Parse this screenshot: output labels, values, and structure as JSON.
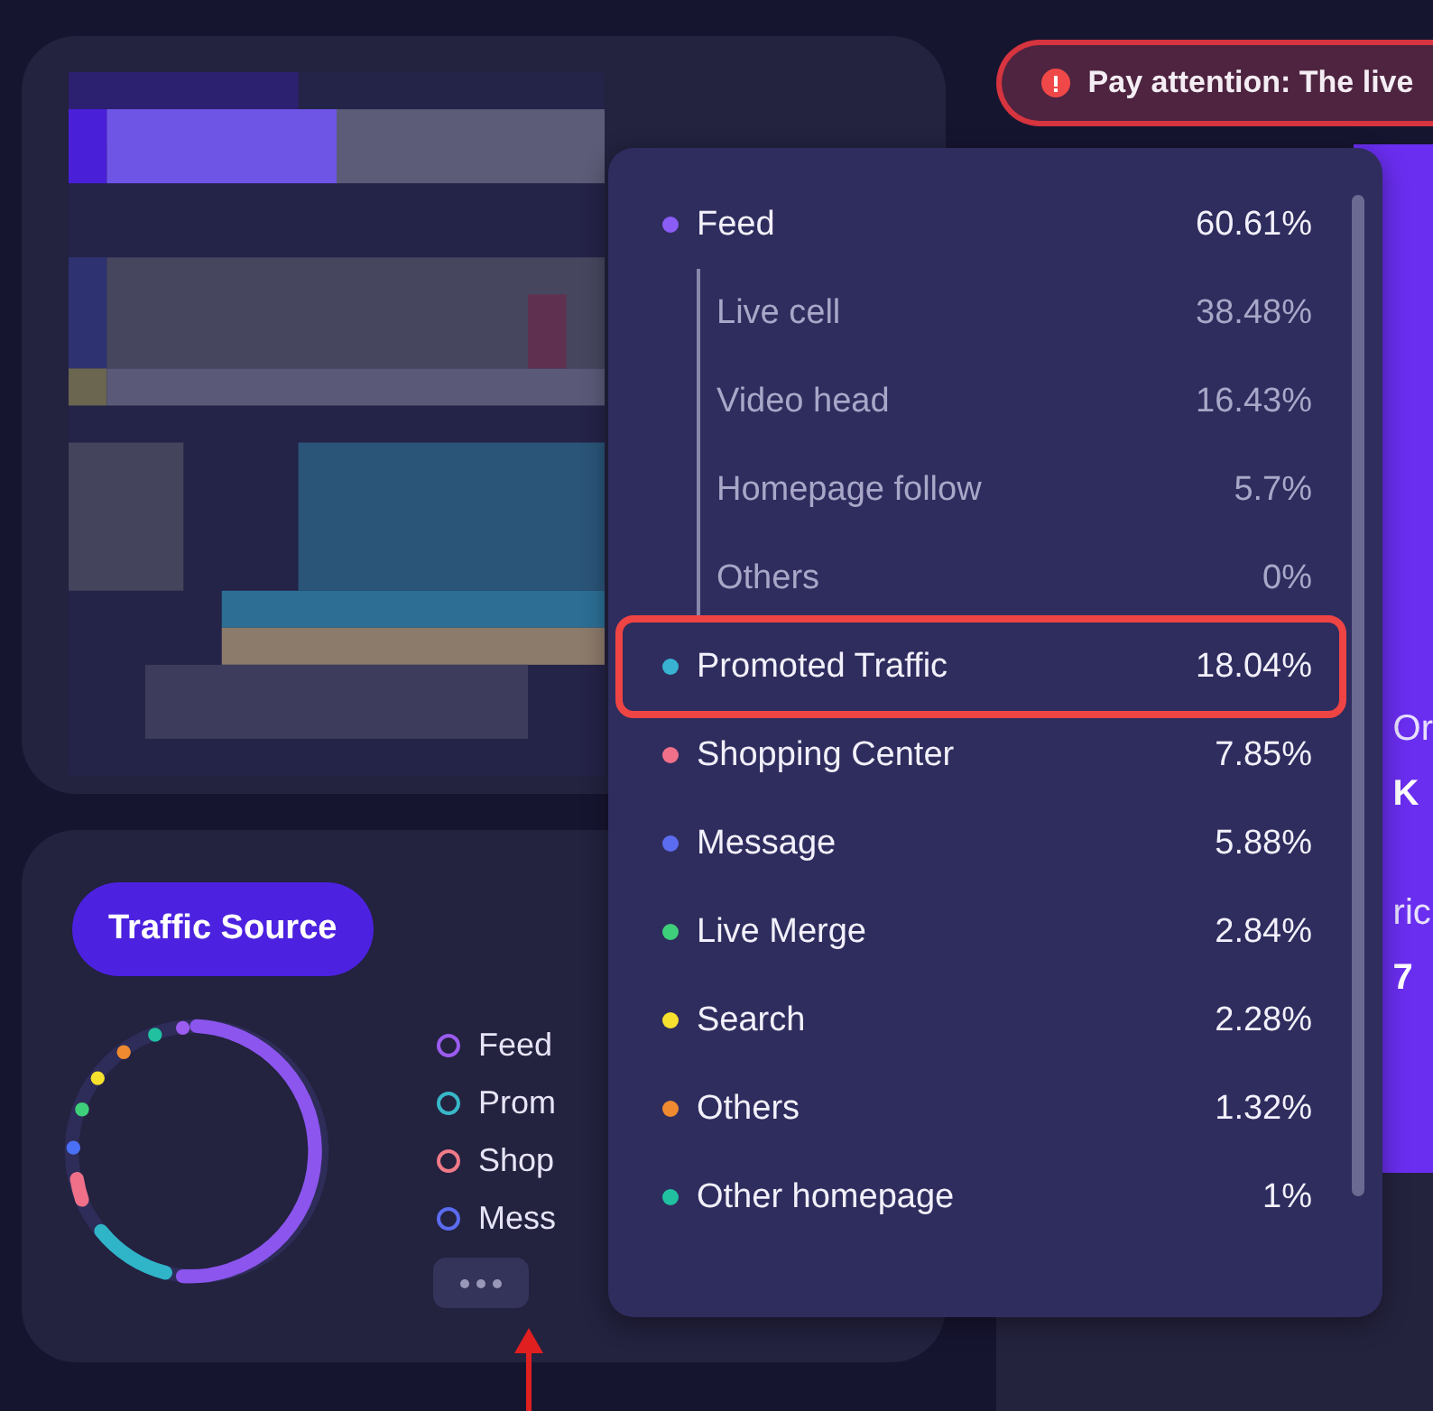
{
  "alert": {
    "text": "Pay attention: The live"
  },
  "traffic_card": {
    "title": "Traffic Source",
    "legend": [
      {
        "label": "Feed",
        "color": "#9b5cf0"
      },
      {
        "label": "Prom",
        "color": "#38b8c8"
      },
      {
        "label": "Shop",
        "color": "#f07a88"
      },
      {
        "label": "Mess",
        "color": "#5b6cf0"
      }
    ]
  },
  "stats_card": {
    "stats": [
      {
        "label": "Or",
        "value": "K"
      },
      {
        "label": "ric",
        "value": "7"
      }
    ]
  },
  "dropdown": {
    "items": [
      {
        "label": "Feed",
        "value": "60.61%",
        "color": "#8b5cf6",
        "highlighted": false,
        "children": [
          {
            "label": "Live cell",
            "value": "38.48%"
          },
          {
            "label": "Video head",
            "value": "16.43%"
          },
          {
            "label": "Homepage follow",
            "value": "5.7%"
          },
          {
            "label": "Others",
            "value": "0%"
          }
        ]
      },
      {
        "label": "Promoted Traffic",
        "value": "18.04%",
        "color": "#38b2d0",
        "highlighted": true
      },
      {
        "label": "Shopping Center",
        "value": "7.85%",
        "color": "#f0708a",
        "highlighted": false
      },
      {
        "label": "Message",
        "value": "5.88%",
        "color": "#5b6cf0",
        "highlighted": false
      },
      {
        "label": "Live Merge",
        "value": "2.84%",
        "color": "#3ecf7a",
        "highlighted": false
      },
      {
        "label": "Search",
        "value": "2.28%",
        "color": "#f5e12e",
        "highlighted": false
      },
      {
        "label": "Others",
        "value": "1.32%",
        "color": "#f08a30",
        "highlighted": false
      },
      {
        "label": "Other homepage",
        "value": "1%",
        "color": "#20c0a0",
        "highlighted": false
      }
    ]
  }
}
